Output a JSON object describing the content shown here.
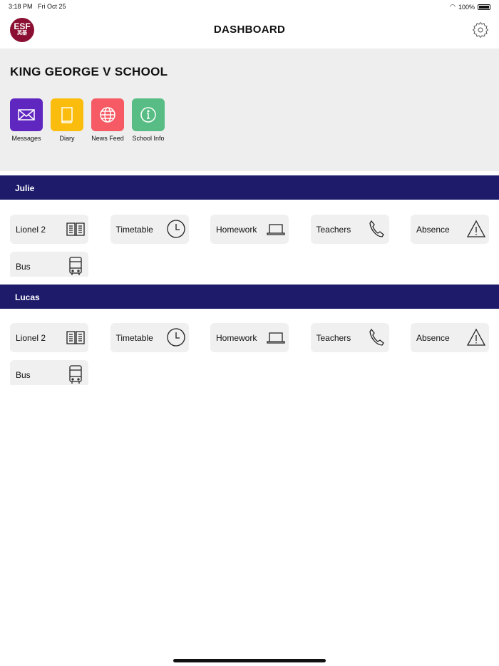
{
  "status": {
    "time": "3:18 PM",
    "date": "Fri Oct 25",
    "battery": "100%"
  },
  "header": {
    "logo_text": "ESF",
    "logo_sub": "英基",
    "title": "DASHBOARD"
  },
  "school": {
    "name": "KING GEORGE V SCHOOL",
    "quick_links": [
      {
        "label": "Messages",
        "icon": "envelope-icon",
        "color": "#5f27c0"
      },
      {
        "label": "Diary",
        "icon": "book-icon",
        "color": "#fbbd0d"
      },
      {
        "label": "News Feed",
        "icon": "globe-icon",
        "color": "#f65a64"
      },
      {
        "label": "School Info",
        "icon": "info-icon",
        "color": "#57bd84"
      }
    ]
  },
  "students": [
    {
      "name": "Julie",
      "tiles": [
        {
          "label": "Lionel 2",
          "icon": "open-book-icon"
        },
        {
          "label": "Timetable",
          "icon": "clock-icon"
        },
        {
          "label": "Homework",
          "icon": "laptop-icon"
        },
        {
          "label": "Teachers",
          "icon": "phone-icon"
        },
        {
          "label": "Absence",
          "icon": "warning-icon"
        },
        {
          "label": "Bus",
          "icon": "bus-icon"
        }
      ]
    },
    {
      "name": "Lucas",
      "tiles": [
        {
          "label": "Lionel 2",
          "icon": "open-book-icon"
        },
        {
          "label": "Timetable",
          "icon": "clock-icon"
        },
        {
          "label": "Homework",
          "icon": "laptop-icon"
        },
        {
          "label": "Teachers",
          "icon": "phone-icon"
        },
        {
          "label": "Absence",
          "icon": "warning-icon"
        },
        {
          "label": "Bus",
          "icon": "bus-icon"
        }
      ]
    }
  ]
}
